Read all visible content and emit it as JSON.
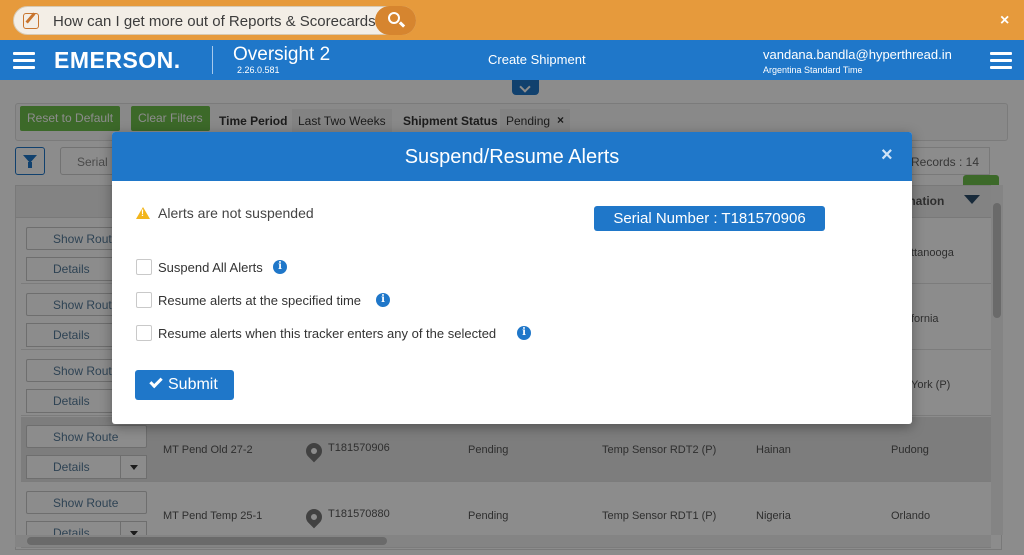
{
  "helpbar": {
    "search_text": "How can I get more out of Reports & Scorecards?",
    "close_label": "×"
  },
  "header": {
    "logo": "EMERSON.",
    "app_name": "Oversight 2",
    "app_version": "2.26.0.581",
    "center_title": "Create Shipment",
    "user_email": "vandana.bandla@hyperthread.in",
    "user_timezone": "Argentina Standard Time"
  },
  "filters": {
    "reset_label": "Reset to Default",
    "clear_label": "Clear Filters",
    "time_period_label": "Time Period",
    "time_period_value": "Last Two Weeks",
    "status_label": "Shipment Status",
    "status_value": "Pending",
    "status_remove": "×"
  },
  "grid": {
    "serial_placeholder": "Serial",
    "records_label": "Records : 14",
    "destination_header": "tination",
    "show_route_label": "Show Route",
    "details_label": "Details",
    "rows": [
      {
        "destination": "ttanooga"
      },
      {
        "destination": "fornia"
      },
      {
        "destination": "York (P)"
      },
      {
        "name": "MT Pend Old 27-2",
        "serial": "T181570906",
        "status": "Pending",
        "product": "Temp Sensor RDT2 (P)",
        "origin": "Hainan",
        "destination": "Pudong"
      },
      {
        "name": "MT Pend Temp 25-1",
        "serial": "T181570880",
        "status": "Pending",
        "product": "Temp Sensor RDT1 (P)",
        "origin": "Nigeria",
        "destination": "Orlando"
      }
    ]
  },
  "modal": {
    "title": "Suspend/Resume Alerts",
    "close": "×",
    "warning": "Alerts are not suspended",
    "serial_badge": "Serial Number : T181570906",
    "options": [
      "Suspend All Alerts",
      "Resume alerts at the specified time",
      "Resume alerts when this tracker enters any of the selected"
    ],
    "submit": "Submit"
  },
  "colors": {
    "brand_blue": "#1f77c9",
    "help_orange": "#e69a3c",
    "green": "#6ebf4c",
    "warn": "#f2b51c"
  }
}
